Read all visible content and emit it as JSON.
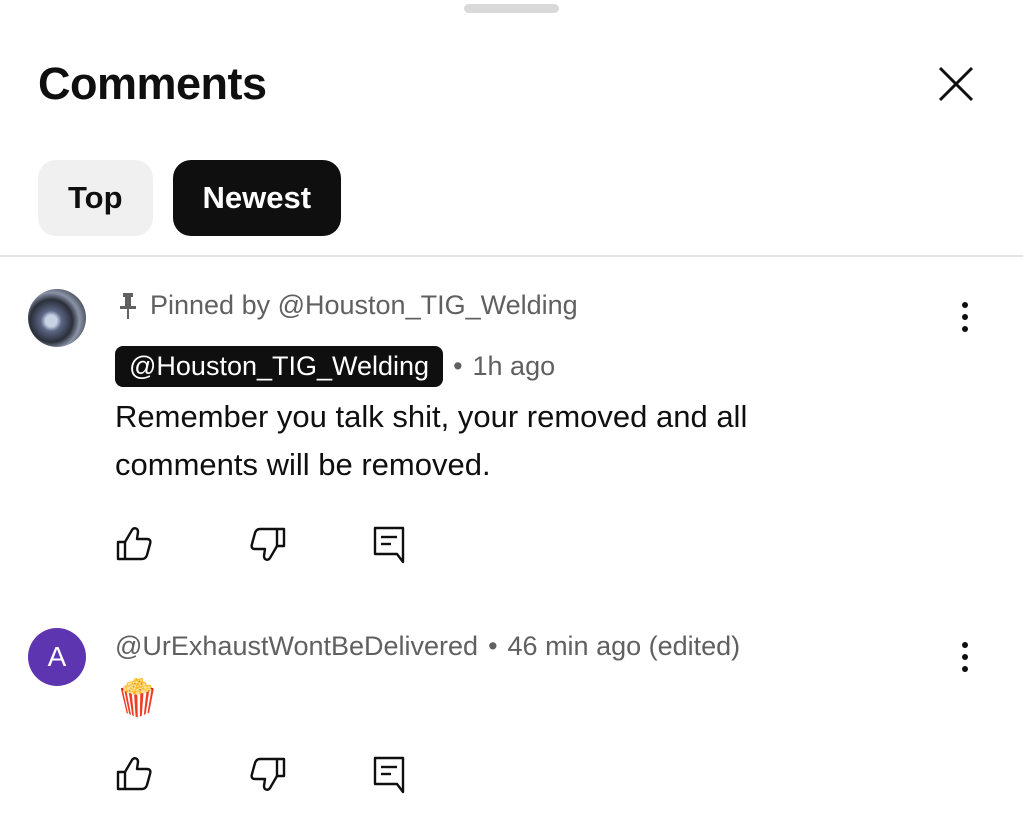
{
  "header": {
    "title": "Comments",
    "close_icon": "close-icon"
  },
  "filters": {
    "items": [
      {
        "label": "Top",
        "active": false
      },
      {
        "label": "Newest",
        "active": true
      }
    ]
  },
  "comments": [
    {
      "pinned_text": "Pinned by @Houston_TIG_Welding",
      "author": "@Houston_TIG_Welding",
      "author_is_creator": true,
      "separator": "•",
      "time": "1h ago",
      "text": "Remember you talk shit, your removed and all comments will be removed.",
      "avatar": "photo"
    },
    {
      "author": "@UrExhaustWontBeDelivered",
      "separator": "•",
      "time": "46 min ago (edited)",
      "text": "🍿",
      "avatar_letter": "A",
      "avatar_color": "#5e35b1"
    }
  ],
  "colors": {
    "text_primary": "#0f0f0f",
    "text_secondary": "#606060",
    "chip_inactive": "#f0f0f0",
    "chip_active": "#0f0f0f"
  }
}
